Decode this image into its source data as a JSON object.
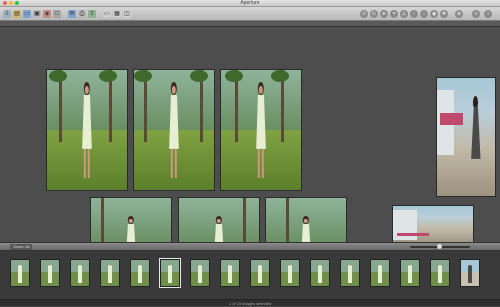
{
  "window": {
    "title": "Aperture",
    "traffic_lights": [
      "#ff5f57",
      "#ffbd2e",
      "#28c840"
    ]
  },
  "toolbar": {
    "left_icons": [
      "import-icon",
      "new-project-icon",
      "folder-icon",
      "album-icon",
      "smart-album-icon",
      "light-table-icon",
      "email-icon",
      "print-icon",
      "export-icon",
      "viewer-mode-icon",
      "browser-mode-icon",
      "split-mode-icon"
    ],
    "right_icons": [
      "rotate-left-icon",
      "rotate-right-icon",
      "selection-icon",
      "crop-icon",
      "straighten-icon",
      "lift-icon",
      "stamp-icon",
      "red-eye-icon",
      "spot-patch-icon",
      "zoom-icon",
      "adjustments-icon",
      "inspector-icon"
    ]
  },
  "filmstrip": {
    "view_label": "Show: All",
    "thumbnail_count": 15,
    "selected_index": 5,
    "slider_value": 0.45,
    "status_text": "1 of 15 images selected"
  },
  "colors": {
    "viewer_bg": "#4d4d4d",
    "toolbar_bg": "#c9c9c9",
    "filmstrip_bg": "#3a3a3a"
  }
}
